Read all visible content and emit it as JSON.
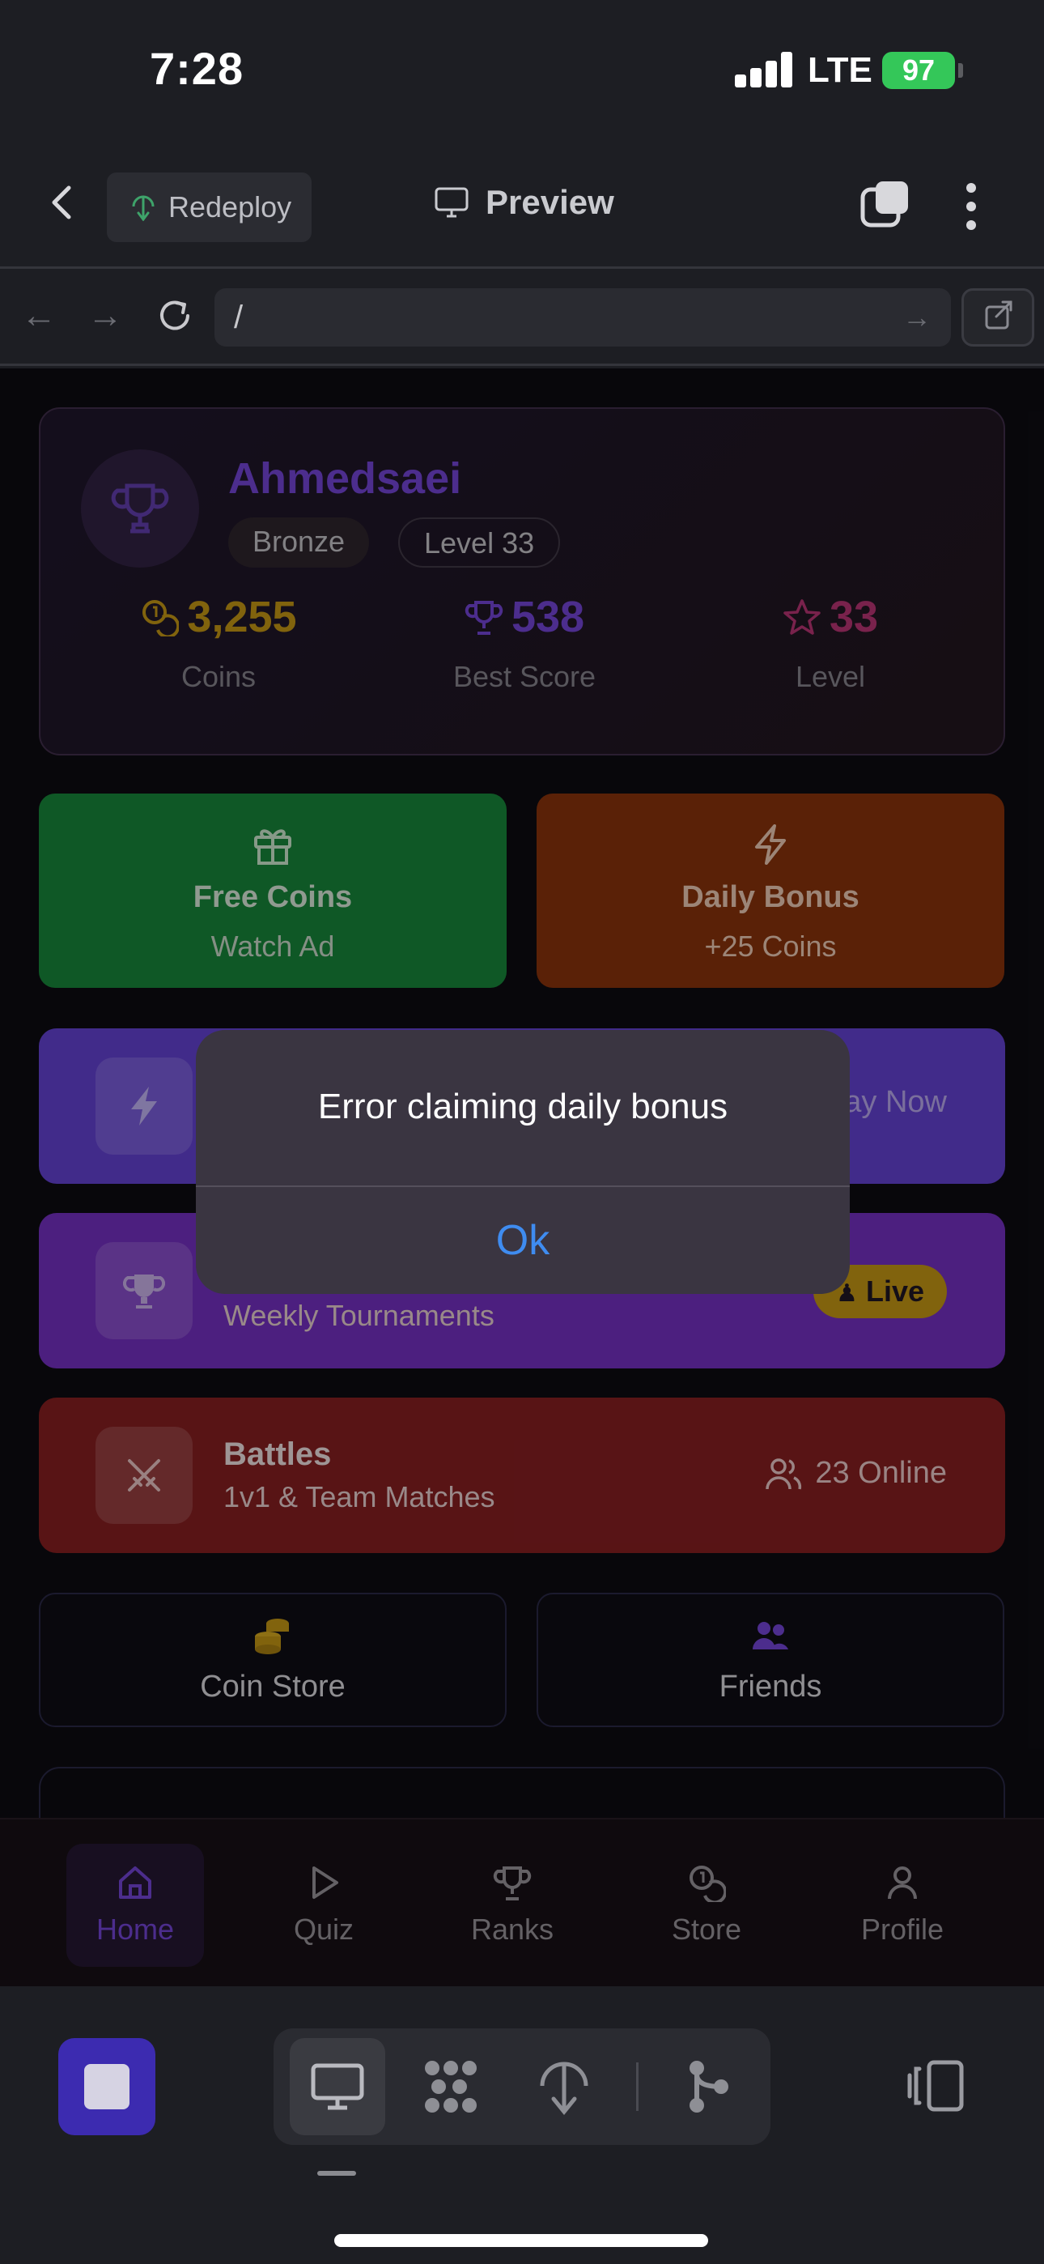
{
  "status_bar": {
    "time": "7:28",
    "network": "LTE",
    "battery": "97"
  },
  "toolbar": {
    "redeploy_label": "Redeploy",
    "preview_label": "Preview"
  },
  "browser": {
    "url": "/"
  },
  "profile": {
    "username": "Ahmedsaei",
    "tier_badge": "Bronze",
    "level_badge": "Level 33",
    "stats": [
      {
        "value": "3,255",
        "label": "Coins",
        "color": "#b38a12"
      },
      {
        "value": "538",
        "label": "Best Score",
        "color": "#6a3fc4"
      },
      {
        "value": "33",
        "label": "Level",
        "color": "#a8306a"
      }
    ]
  },
  "actions": {
    "free_coins": {
      "title": "Free Coins",
      "subtitle": "Watch Ad"
    },
    "daily_bonus": {
      "title": "Daily Bonus",
      "subtitle": "+25 Coins"
    }
  },
  "features": {
    "quick_play": {
      "action": "ay Now"
    },
    "tournaments": {
      "subtitle": "Weekly Tournaments",
      "badge": "Live"
    },
    "battles": {
      "title": "Battles",
      "subtitle": "1v1 & Team Matches",
      "online": "23 Online"
    }
  },
  "shortcuts": {
    "coin_store": "Coin Store",
    "friends": "Friends"
  },
  "tabs": [
    {
      "label": "Home",
      "active": true
    },
    {
      "label": "Quiz",
      "active": false
    },
    {
      "label": "Ranks",
      "active": false
    },
    {
      "label": "Store",
      "active": false
    },
    {
      "label": "Profile",
      "active": false
    }
  ],
  "alert": {
    "message": "Error claiming daily bonus",
    "ok_label": "Ok"
  },
  "colors": {
    "accent": "#6a3fc4",
    "alert_button": "#3f8cf0",
    "free_coins": "#167a35",
    "daily_bonus": "#7d2e0a",
    "battles": "#7a1c1e"
  }
}
